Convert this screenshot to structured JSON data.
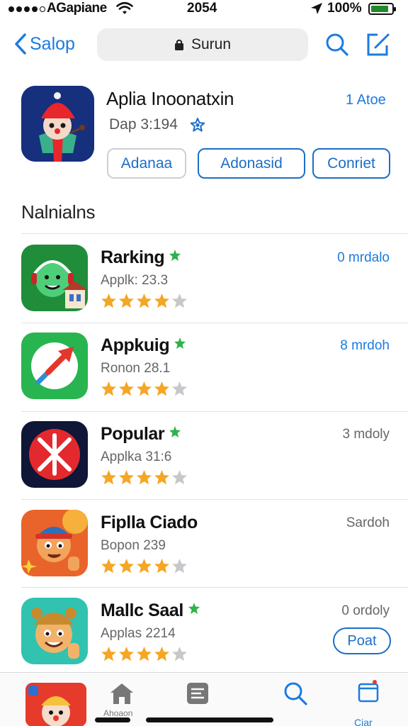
{
  "status_bar": {
    "carrier": "AGapiane",
    "time": "2054",
    "battery": "100%"
  },
  "nav": {
    "back_label": "Salop",
    "search_text": "Surun"
  },
  "app": {
    "title": "Aplia Inoonatxin",
    "subtitle": "Dap 3:194",
    "action": "1 Atoe",
    "buttons": [
      "Adanaa",
      "Adonasid",
      "Conriet"
    ]
  },
  "section": {
    "title": "Nalnialns"
  },
  "list": [
    {
      "name": "Rarking",
      "meta": "Applk: 23.3",
      "right": "0 mrdalo",
      "rating": 4
    },
    {
      "name": "Appkuig",
      "meta": "Ronon 28.1",
      "right": "8 mrdoh",
      "rating": 4
    },
    {
      "name": "Popular",
      "meta": "Applka 31:6",
      "right": "3 mdoly",
      "rating": 4
    },
    {
      "name": "Fiplla Ciado",
      "meta": "Bopon 239",
      "right": "Sardoh",
      "rating": 4
    },
    {
      "name": "Mallc Saal",
      "meta": "Applas 2214",
      "right": "0 ordoly",
      "rating": 4,
      "button": "Poat"
    }
  ],
  "tabbar": {
    "home_label": "Ahoaon",
    "cart_label": "Ciar"
  },
  "colors": {
    "accent": "#1b7be0",
    "star": "#f5a623",
    "star_empty": "#c8c8cc",
    "badge": "#2fb34a"
  }
}
